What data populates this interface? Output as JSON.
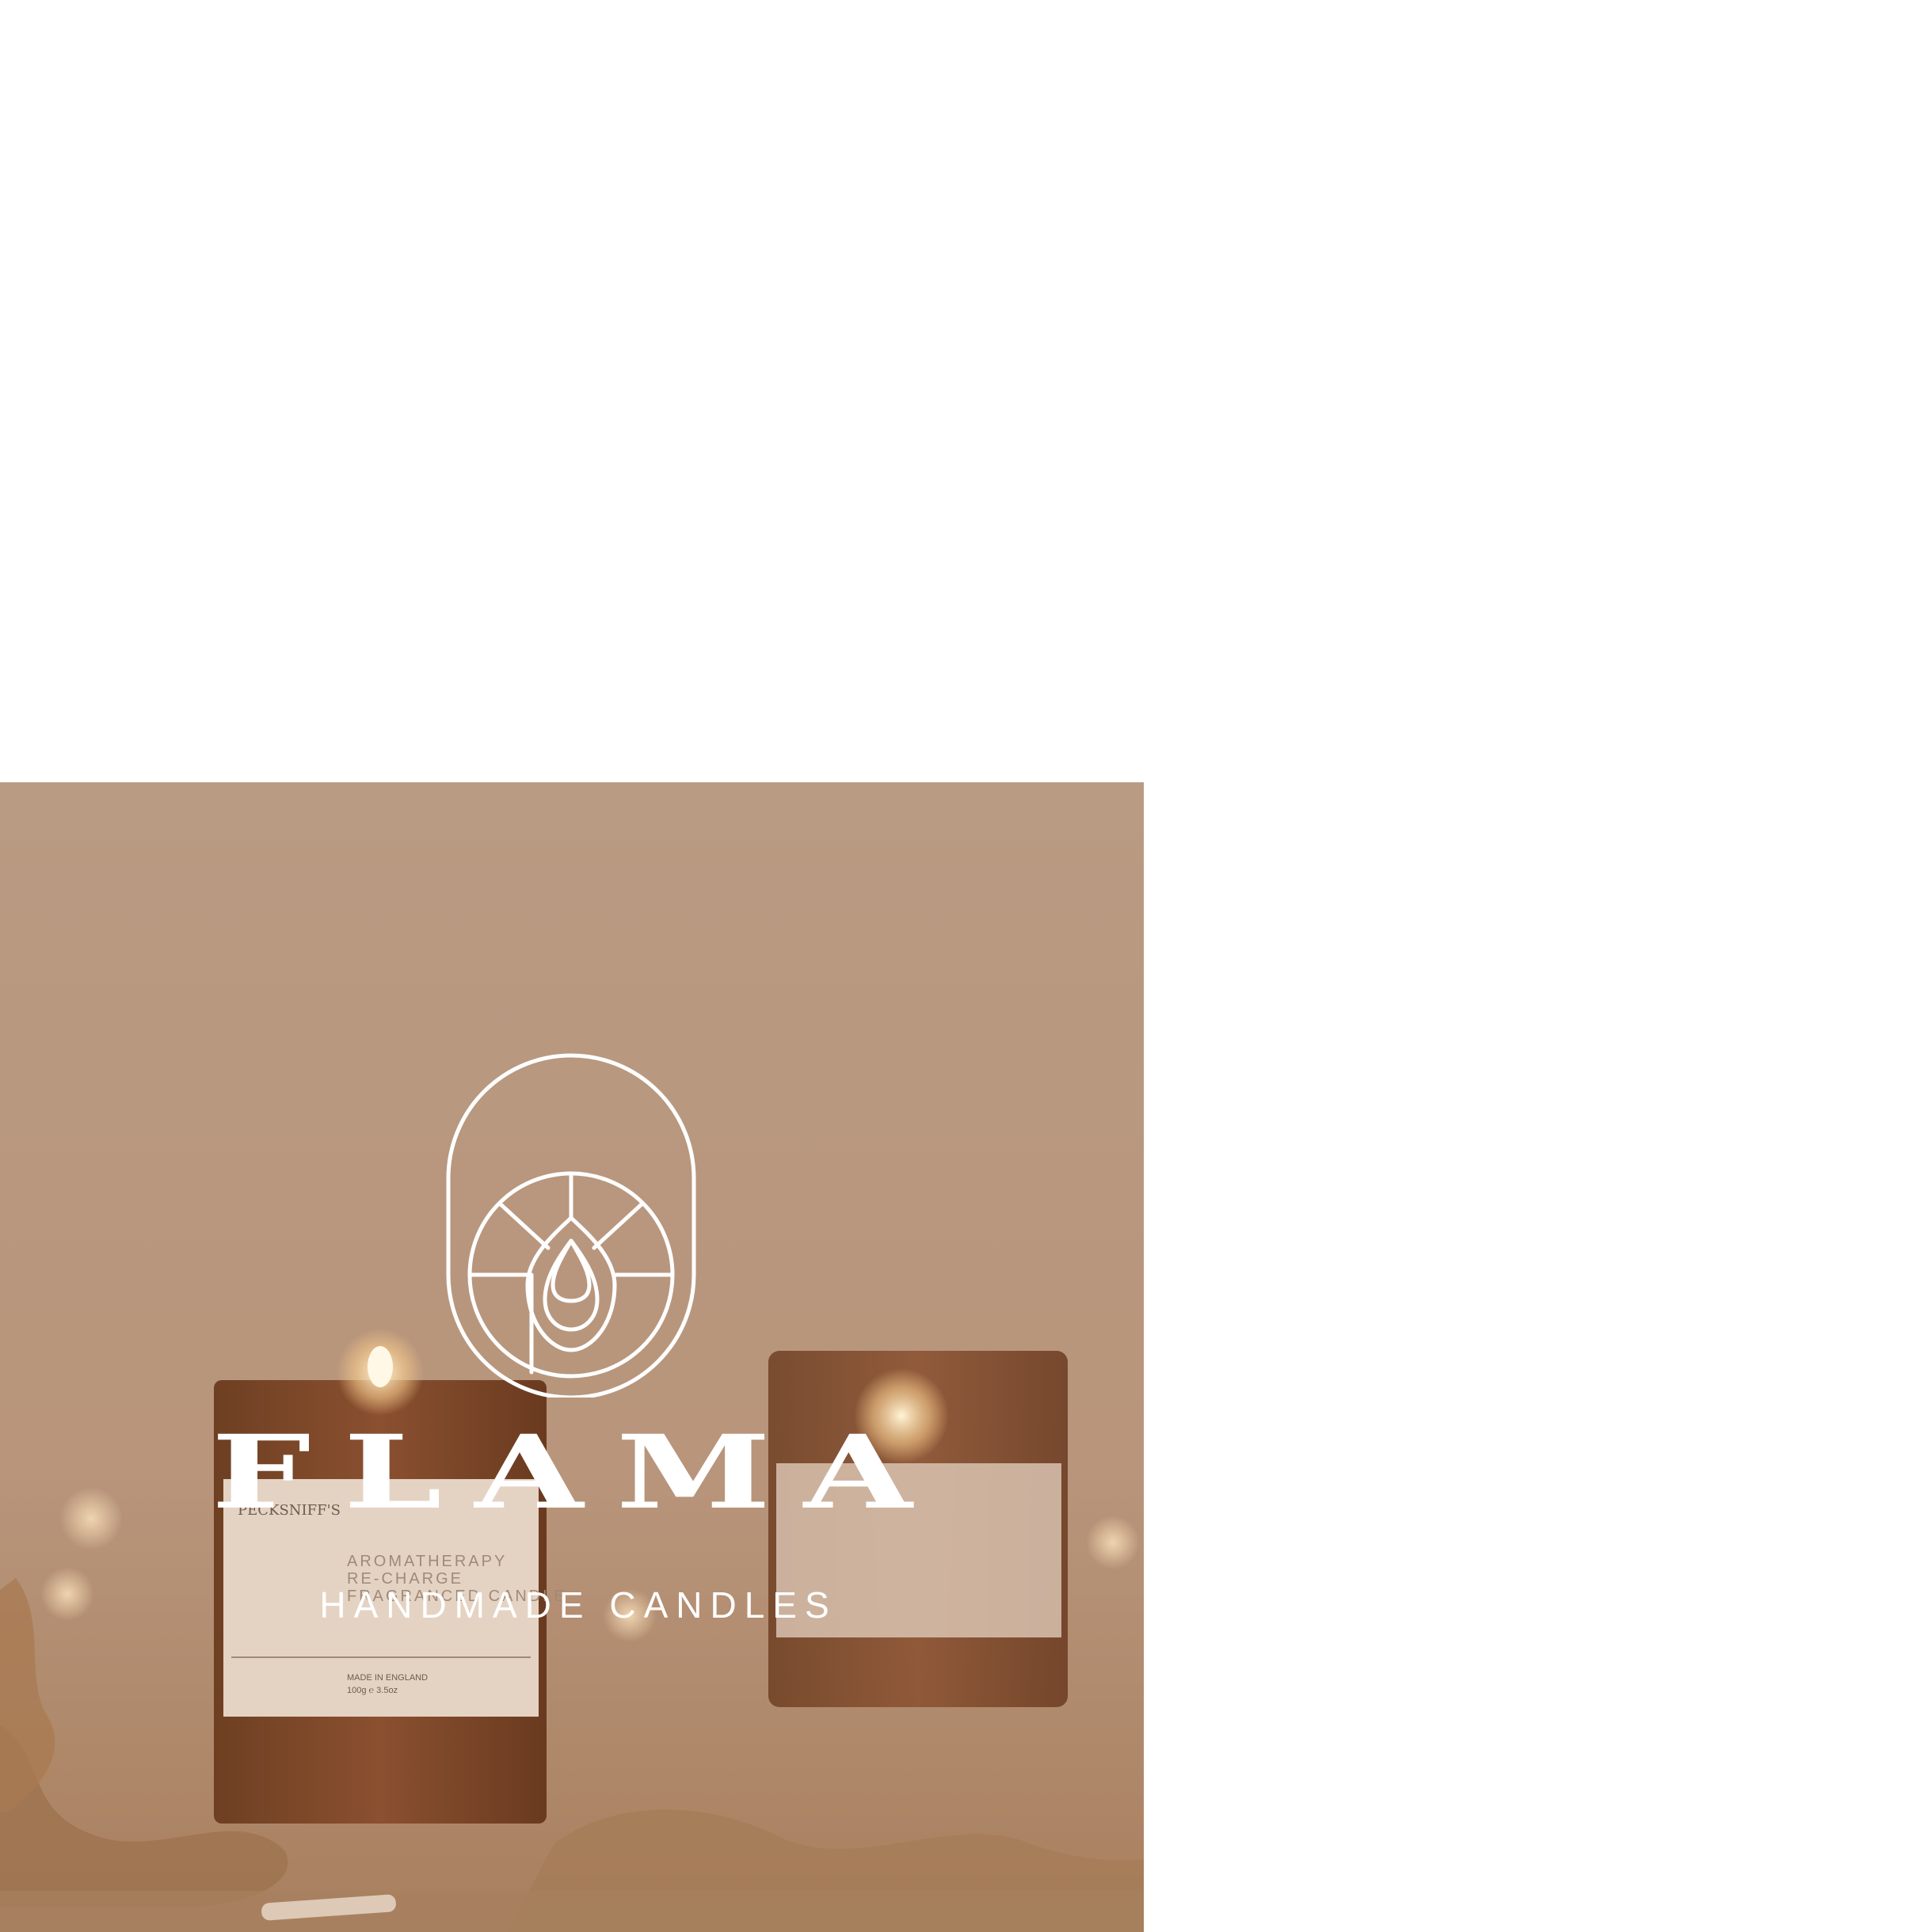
{
  "brand": {
    "name": "FLAMA",
    "tagline": "HANDMADE CANDLES"
  },
  "photo": {
    "label_brand": "PECKSNIFF'S",
    "label_line1": "AROMATHERAPY",
    "label_line2": "RE-CHARGE",
    "label_line3": "FRAGRANCED CANDLE",
    "label_origin": "MADE IN ENGLAND",
    "label_weight": "100g ℮ 3.5oz"
  },
  "colors": {
    "overlay": "#b8977e",
    "logo": "#ffffff",
    "background": "#ffffff"
  },
  "icons": {
    "logo": "candle-flame-arch-logo-icon"
  }
}
